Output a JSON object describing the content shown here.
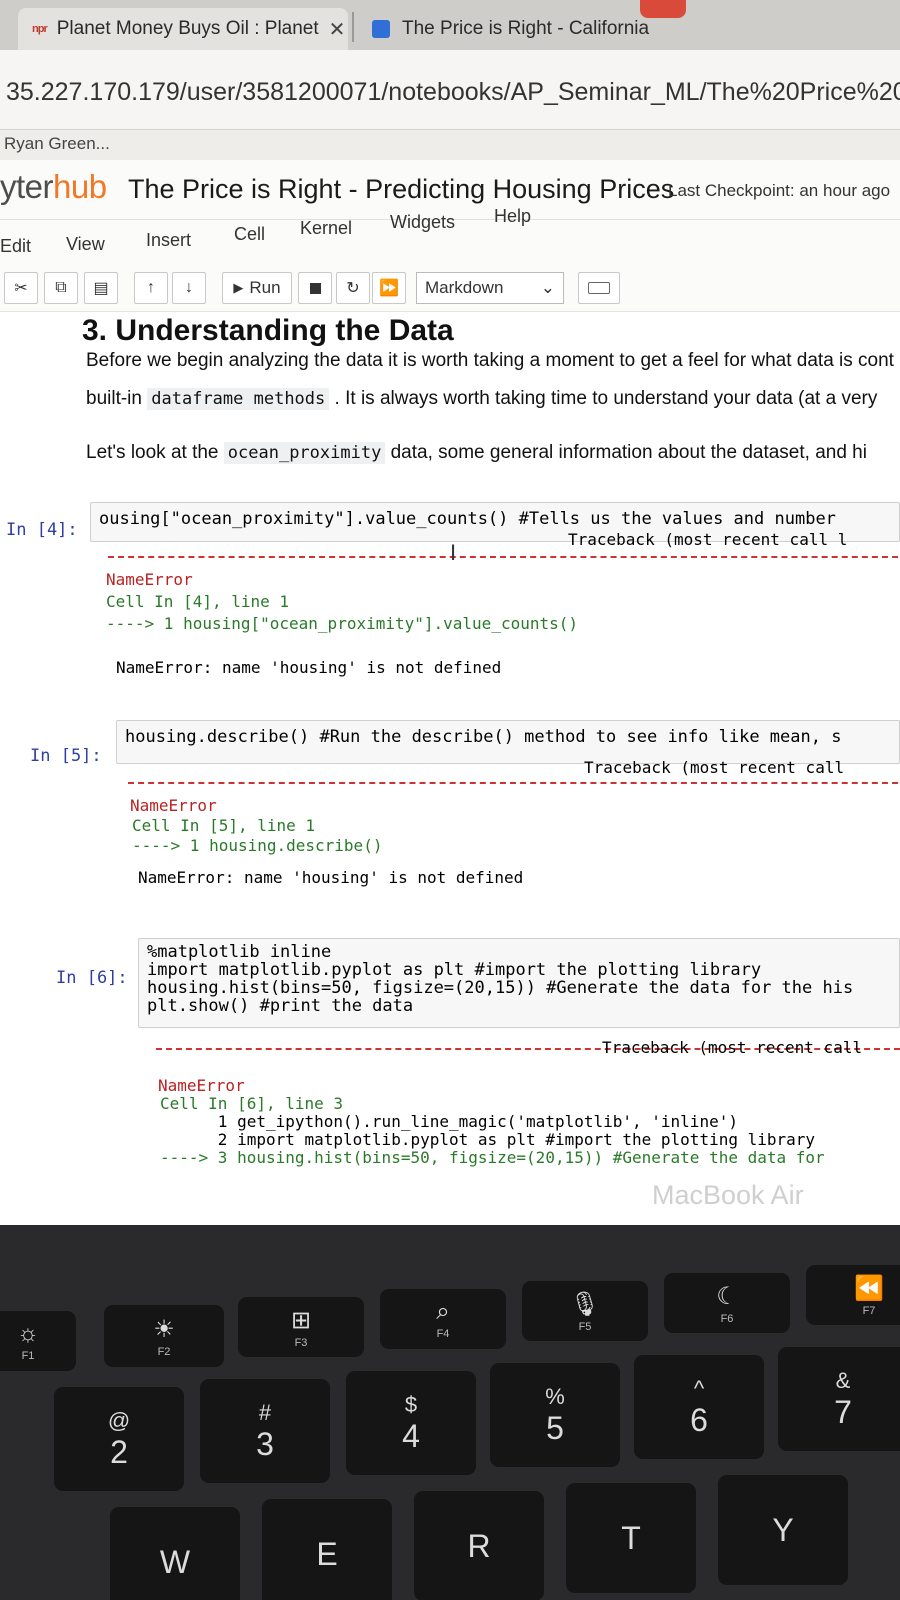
{
  "browser": {
    "tabs": [
      {
        "label": "Planet Money Buys Oil : Planet",
        "favicon": "npr",
        "close": "✕"
      },
      {
        "label": "The Price is Right - California",
        "favicon": "jupyter"
      }
    ],
    "url": "35.227.170.179/user/3581200071/notebooks/AP_Seminar_ML/The%20Price%20is%20Right%20-%",
    "bookmark": "Ryan Green..."
  },
  "jupyter": {
    "logo_dark": "yter",
    "logo_orange": "hub",
    "notebook_title": "The Price is Right - Predicting Housing Prices",
    "checkpoint": "Last Checkpoint: an hour ago",
    "menu": [
      "Edit",
      "View",
      "Insert",
      "Cell",
      "Kernel",
      "Widgets",
      "Help"
    ],
    "toolbar": {
      "run_label": "Run",
      "cell_type": "Markdown"
    }
  },
  "notebook": {
    "heading": "3. Understanding the Data",
    "para1_a": "Before we begin analyzing the data it is worth taking a moment to get a feel for what data is cont",
    "para1_b": "built-in",
    "para1_code": "dataframe methods",
    "para1_c": ". It is always worth taking time to understand your data (at a very",
    "para2_a": "Let's look at the",
    "para2_code": "ocean_proximity",
    "para2_b": "data, some general information about the dataset, and hi",
    "cells": [
      {
        "prompt": "In [4]:",
        "code": "ousing[\"ocean_proximity\"].value_counts() #Tells us the values and number",
        "traceback": "Traceback (most recent call l",
        "err_name": "NameError",
        "err_loc": "Cell In [4], line 1",
        "err_line": "----> 1 housing[\"ocean_proximity\"].value_counts()",
        "err_msg": "NameError: name 'housing' is not defined"
      },
      {
        "prompt": "In [5]:",
        "code": "housing.describe() #Run the describe() method to see info like mean, s",
        "traceback": "Traceback (most recent call",
        "err_name": "NameError",
        "err_loc": "Cell In [5], line 1",
        "err_line": "----> 1 housing.describe()",
        "err_msg": "NameError: name 'housing' is not defined"
      },
      {
        "prompt": "In [6]:",
        "code_lines": [
          "%matplotlib inline",
          "import matplotlib.pyplot as plt #import the plotting library",
          "housing.hist(bins=50, figsize=(20,15)) #Generate the data for the his",
          "plt.show() #print the data"
        ],
        "traceback": "Traceback (most recent call",
        "err_name": "NameError",
        "err_loc": "Cell In [6], line 3",
        "err_lines": [
          "      1 get_ipython().run_line_magic('matplotlib', 'inline')",
          "      2 import matplotlib.pyplot as plt #import the plotting library",
          "----> 3 housing.hist(bins=50, figsize=(20,15)) #Generate the data for"
        ]
      }
    ]
  },
  "bezel": "MacBook Air",
  "keyboard": {
    "fn_row": [
      "F1",
      "F2",
      "F3",
      "F4",
      "F5",
      "F6",
      "F7"
    ],
    "num_row": [
      {
        "top": "@",
        "bottom": "2"
      },
      {
        "top": "#",
        "bottom": "3"
      },
      {
        "top": "$",
        "bottom": "4"
      },
      {
        "top": "%",
        "bottom": "5"
      },
      {
        "top": "^",
        "bottom": "6"
      },
      {
        "top": "&",
        "bottom": "7"
      }
    ],
    "letters": [
      "W",
      "E",
      "R",
      "T",
      "Y"
    ]
  },
  "colors": {
    "jupyter_orange": "#f37726",
    "prompt_blue": "#303f9f",
    "error_red": "#b22222",
    "highlight": "#f2d188"
  }
}
